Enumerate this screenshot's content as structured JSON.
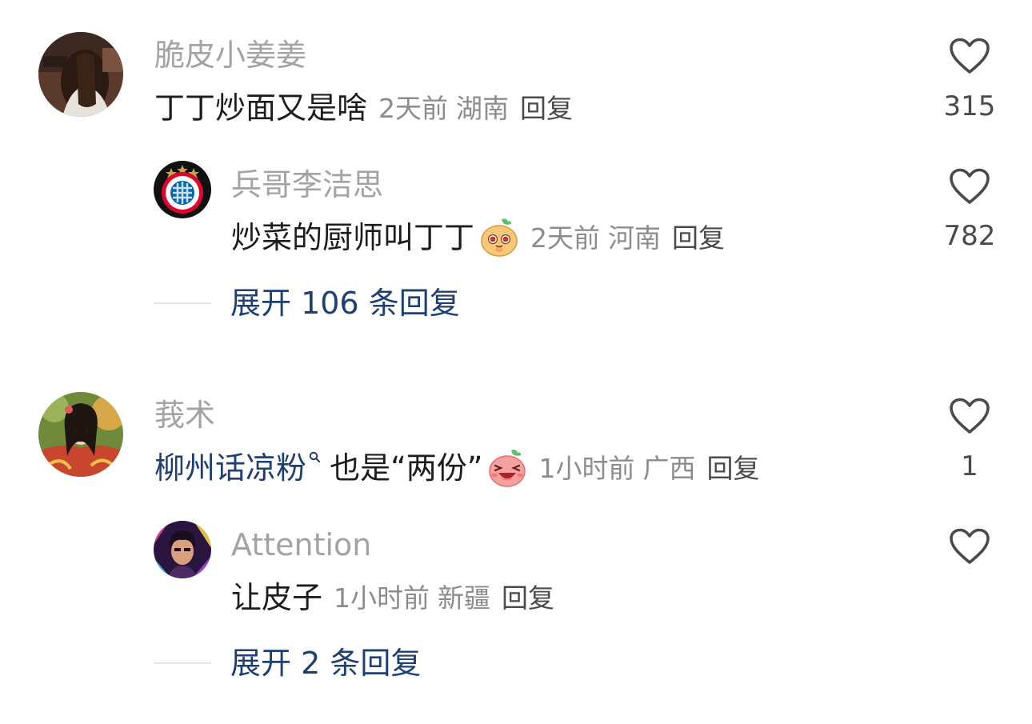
{
  "comments": [
    {
      "username": "脆皮小姜姜",
      "text": "丁丁炒面又是啥",
      "time": "2天前",
      "location": "湖南",
      "reply_label": "回复",
      "likes": "315",
      "avatar_icon": "avatar-photo-girl-back",
      "replies": [
        {
          "username": "兵哥李洁思",
          "text": "炒菜的厨师叫丁丁",
          "emoji": "cute-face-emoji",
          "time": "2天前",
          "location": "河南",
          "reply_label": "回复",
          "likes": "782",
          "avatar_icon": "fc-bayern-logo"
        }
      ],
      "expand_label": "展开 106 条回复"
    },
    {
      "username": "莪术",
      "link_text": "柳州话凉粉",
      "link_icon": "search-icon",
      "text": " 也是“两份”",
      "emoji": "laughing-face-emoji",
      "time": "1小时前",
      "location": "广西",
      "reply_label": "回复",
      "likes": "1",
      "avatar_icon": "avatar-photo-girl-colorful",
      "replies": [
        {
          "username": "Attention",
          "text": "让皮子",
          "time": "1小时前",
          "location": "新疆",
          "reply_label": "回复",
          "likes": "",
          "avatar_icon": "avatar-neon-portrait"
        }
      ],
      "expand_label": "展开 2 条回复"
    }
  ],
  "colors": {
    "link": "#1e3f72",
    "username": "#a3a3a3",
    "meta": "#8c8c8c",
    "text": "#1d1d1d"
  }
}
